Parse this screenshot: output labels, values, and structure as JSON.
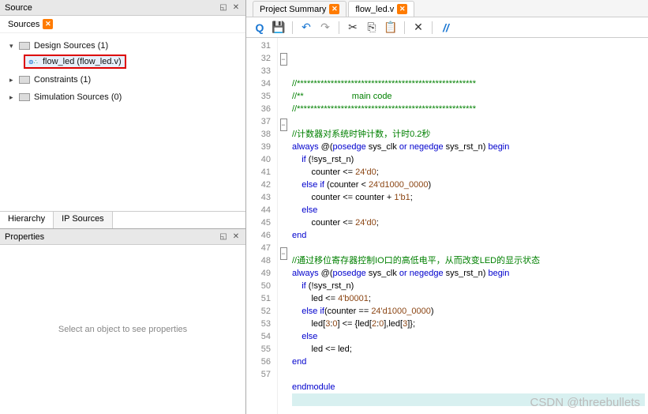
{
  "source_panel": {
    "title": "Source",
    "sub_title": "Sources",
    "tree": {
      "design_sources": "Design Sources (1)",
      "flow_led": "flow_led (flow_led.v)",
      "constraints": "Constraints (1)",
      "simulation": "Simulation Sources (0)"
    },
    "tabs": {
      "hierarchy": "Hierarchy",
      "ip_sources": "IP Sources"
    }
  },
  "properties_panel": {
    "title": "Properties",
    "empty_text": "Select an object to see properties"
  },
  "editor_tabs": {
    "summary": "Project Summary",
    "file": "flow_led.v"
  },
  "code": {
    "lines": [
      {
        "n": 31,
        "t": ""
      },
      {
        "n": 32,
        "fold": "-",
        "segs": [
          {
            "c": "c-green",
            "t": "//*****************************************************"
          }
        ]
      },
      {
        "n": 33,
        "segs": [
          {
            "c": "c-green",
            "t": "//**                    main code"
          }
        ]
      },
      {
        "n": 34,
        "segs": [
          {
            "c": "c-green",
            "t": "//*****************************************************"
          }
        ]
      },
      {
        "n": 35,
        "t": ""
      },
      {
        "n": 36,
        "segs": [
          {
            "c": "c-green",
            "t": "//计数器对系统时钟计数，计时0.2秒"
          }
        ]
      },
      {
        "n": 37,
        "fold": "-",
        "segs": [
          {
            "c": "c-blue",
            "t": "always"
          },
          {
            "c": "c-black",
            "t": " @("
          },
          {
            "c": "c-blue",
            "t": "posedge"
          },
          {
            "c": "c-black",
            "t": " sys_clk "
          },
          {
            "c": "c-blue",
            "t": "or"
          },
          {
            "c": "c-black",
            "t": " "
          },
          {
            "c": "c-blue",
            "t": "negedge"
          },
          {
            "c": "c-black",
            "t": " sys_rst_n) "
          },
          {
            "c": "c-blue",
            "t": "begin"
          }
        ]
      },
      {
        "n": 38,
        "segs": [
          {
            "c": "c-black",
            "t": "    "
          },
          {
            "c": "c-blue",
            "t": "if"
          },
          {
            "c": "c-black",
            "t": " (!sys_rst_n)"
          }
        ]
      },
      {
        "n": 39,
        "segs": [
          {
            "c": "c-black",
            "t": "        counter <= "
          },
          {
            "c": "c-brown",
            "t": "24'd0"
          },
          {
            "c": "c-black",
            "t": ";"
          }
        ]
      },
      {
        "n": 40,
        "segs": [
          {
            "c": "c-black",
            "t": "    "
          },
          {
            "c": "c-blue",
            "t": "else"
          },
          {
            "c": "c-black",
            "t": " "
          },
          {
            "c": "c-blue",
            "t": "if"
          },
          {
            "c": "c-black",
            "t": " (counter < "
          },
          {
            "c": "c-brown",
            "t": "24'd1000_0000"
          },
          {
            "c": "c-black",
            "t": ")"
          }
        ]
      },
      {
        "n": 41,
        "segs": [
          {
            "c": "c-black",
            "t": "        counter <= counter + "
          },
          {
            "c": "c-brown",
            "t": "1'b1"
          },
          {
            "c": "c-black",
            "t": ";"
          }
        ]
      },
      {
        "n": 42,
        "segs": [
          {
            "c": "c-black",
            "t": "    "
          },
          {
            "c": "c-blue",
            "t": "else"
          }
        ]
      },
      {
        "n": 43,
        "segs": [
          {
            "c": "c-black",
            "t": "        counter <= "
          },
          {
            "c": "c-brown",
            "t": "24'd0"
          },
          {
            "c": "c-black",
            "t": ";"
          }
        ]
      },
      {
        "n": 44,
        "segs": [
          {
            "c": "c-blue",
            "t": "end"
          }
        ]
      },
      {
        "n": 45,
        "t": ""
      },
      {
        "n": 46,
        "segs": [
          {
            "c": "c-green",
            "t": "//通过移位寄存器控制IO口的高低电平，从而改变LED的显示状态"
          }
        ]
      },
      {
        "n": 47,
        "fold": "-",
        "segs": [
          {
            "c": "c-blue",
            "t": "always"
          },
          {
            "c": "c-black",
            "t": " @("
          },
          {
            "c": "c-blue",
            "t": "posedge"
          },
          {
            "c": "c-black",
            "t": " sys_clk "
          },
          {
            "c": "c-blue",
            "t": "or"
          },
          {
            "c": "c-black",
            "t": " "
          },
          {
            "c": "c-blue",
            "t": "negedge"
          },
          {
            "c": "c-black",
            "t": " sys_rst_n) "
          },
          {
            "c": "c-blue",
            "t": "begin"
          }
        ]
      },
      {
        "n": 48,
        "segs": [
          {
            "c": "c-black",
            "t": "    "
          },
          {
            "c": "c-blue",
            "t": "if"
          },
          {
            "c": "c-black",
            "t": " (!sys_rst_n)"
          }
        ]
      },
      {
        "n": 49,
        "segs": [
          {
            "c": "c-black",
            "t": "        led <= "
          },
          {
            "c": "c-brown",
            "t": "4'b0001"
          },
          {
            "c": "c-black",
            "t": ";"
          }
        ]
      },
      {
        "n": 50,
        "segs": [
          {
            "c": "c-black",
            "t": "    "
          },
          {
            "c": "c-blue",
            "t": "else"
          },
          {
            "c": "c-black",
            "t": " "
          },
          {
            "c": "c-blue",
            "t": "if"
          },
          {
            "c": "c-black",
            "t": "(counter == "
          },
          {
            "c": "c-brown",
            "t": "24'd1000_0000"
          },
          {
            "c": "c-black",
            "t": ")"
          }
        ]
      },
      {
        "n": 51,
        "segs": [
          {
            "c": "c-black",
            "t": "        led["
          },
          {
            "c": "c-brown",
            "t": "3"
          },
          {
            "c": "c-black",
            "t": ":"
          },
          {
            "c": "c-brown",
            "t": "0"
          },
          {
            "c": "c-black",
            "t": "] <= {led["
          },
          {
            "c": "c-brown",
            "t": "2"
          },
          {
            "c": "c-black",
            "t": ":"
          },
          {
            "c": "c-brown",
            "t": "0"
          },
          {
            "c": "c-black",
            "t": "],led["
          },
          {
            "c": "c-brown",
            "t": "3"
          },
          {
            "c": "c-black",
            "t": "]};"
          }
        ]
      },
      {
        "n": 52,
        "segs": [
          {
            "c": "c-black",
            "t": "    "
          },
          {
            "c": "c-blue",
            "t": "else"
          }
        ]
      },
      {
        "n": 53,
        "segs": [
          {
            "c": "c-black",
            "t": "        led <= led;"
          }
        ]
      },
      {
        "n": 54,
        "segs": [
          {
            "c": "c-blue",
            "t": "end"
          }
        ]
      },
      {
        "n": 55,
        "t": ""
      },
      {
        "n": 56,
        "segs": [
          {
            "c": "c-blue",
            "t": "endmodule"
          }
        ]
      },
      {
        "n": 57,
        "hl": true,
        "t": ""
      }
    ]
  },
  "watermark": "CSDN @threebullets"
}
